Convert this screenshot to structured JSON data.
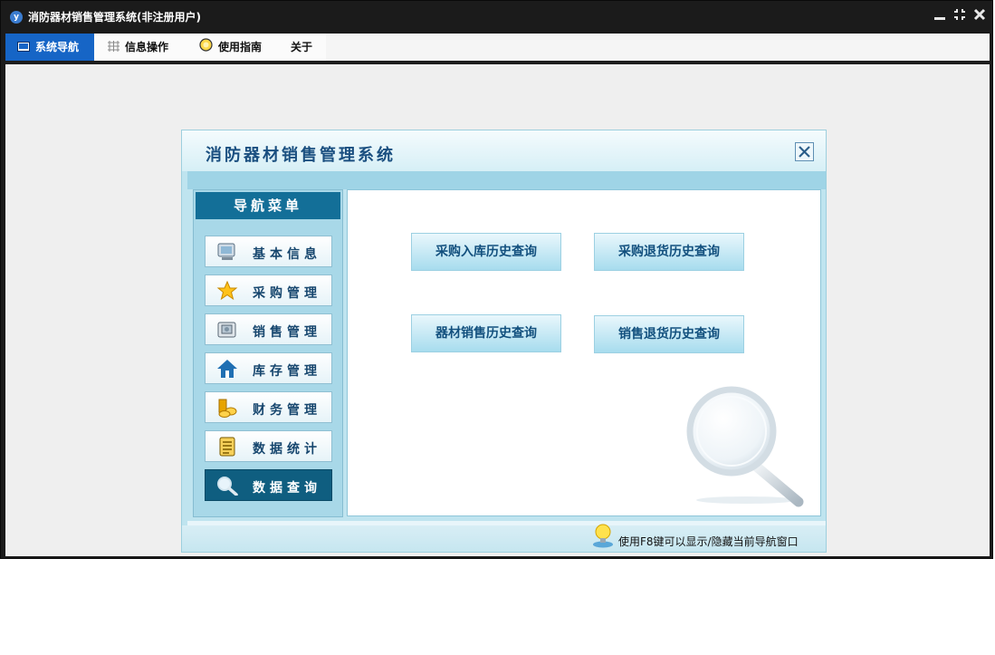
{
  "window": {
    "title": "消防器材销售管理系统(非注册用户)",
    "app_icon": "app-logo-icon",
    "controls": [
      "minimize-icon",
      "restore-icon",
      "close-icon"
    ]
  },
  "menu": {
    "tabs": [
      {
        "label": "系统导航",
        "icon": "monitor-icon",
        "active": true
      },
      {
        "label": "信息操作",
        "icon": "grid-icon",
        "active": false
      },
      {
        "label": "使用指南",
        "icon": "lightbulb-icon",
        "active": false
      },
      {
        "label": "关于",
        "icon": "",
        "active": false
      }
    ]
  },
  "dialog": {
    "title": "消防器材销售管理系统",
    "nav": {
      "header": "导航菜单",
      "items": [
        {
          "label": "基本信息",
          "icon": "monitor-icon",
          "active": false
        },
        {
          "label": "采购管理",
          "icon": "star-icon",
          "active": false
        },
        {
          "label": "销售管理",
          "icon": "photo-album-icon",
          "active": false
        },
        {
          "label": "库存管理",
          "icon": "house-icon",
          "active": false
        },
        {
          "label": "财务管理",
          "icon": "coins-icon",
          "active": false
        },
        {
          "label": "数据统计",
          "icon": "document-icon",
          "active": false
        },
        {
          "label": "数据查询",
          "icon": "magnifier-icon",
          "active": true
        }
      ]
    },
    "query_buttons": [
      "采购入库历史查询",
      "采购退货历史查询",
      "器材销售历史查询",
      "销售退货历史查询"
    ],
    "footer_hint": "使用F8键可以显示/隐藏当前导航窗口"
  },
  "colors": {
    "title_bar": "#1b1b1b",
    "active_tab": "#1665c6",
    "dialog_bg": "#bfe4ef",
    "nav_header": "#136f98",
    "active_nav": "#0f5e80",
    "query_text": "#12507e"
  }
}
